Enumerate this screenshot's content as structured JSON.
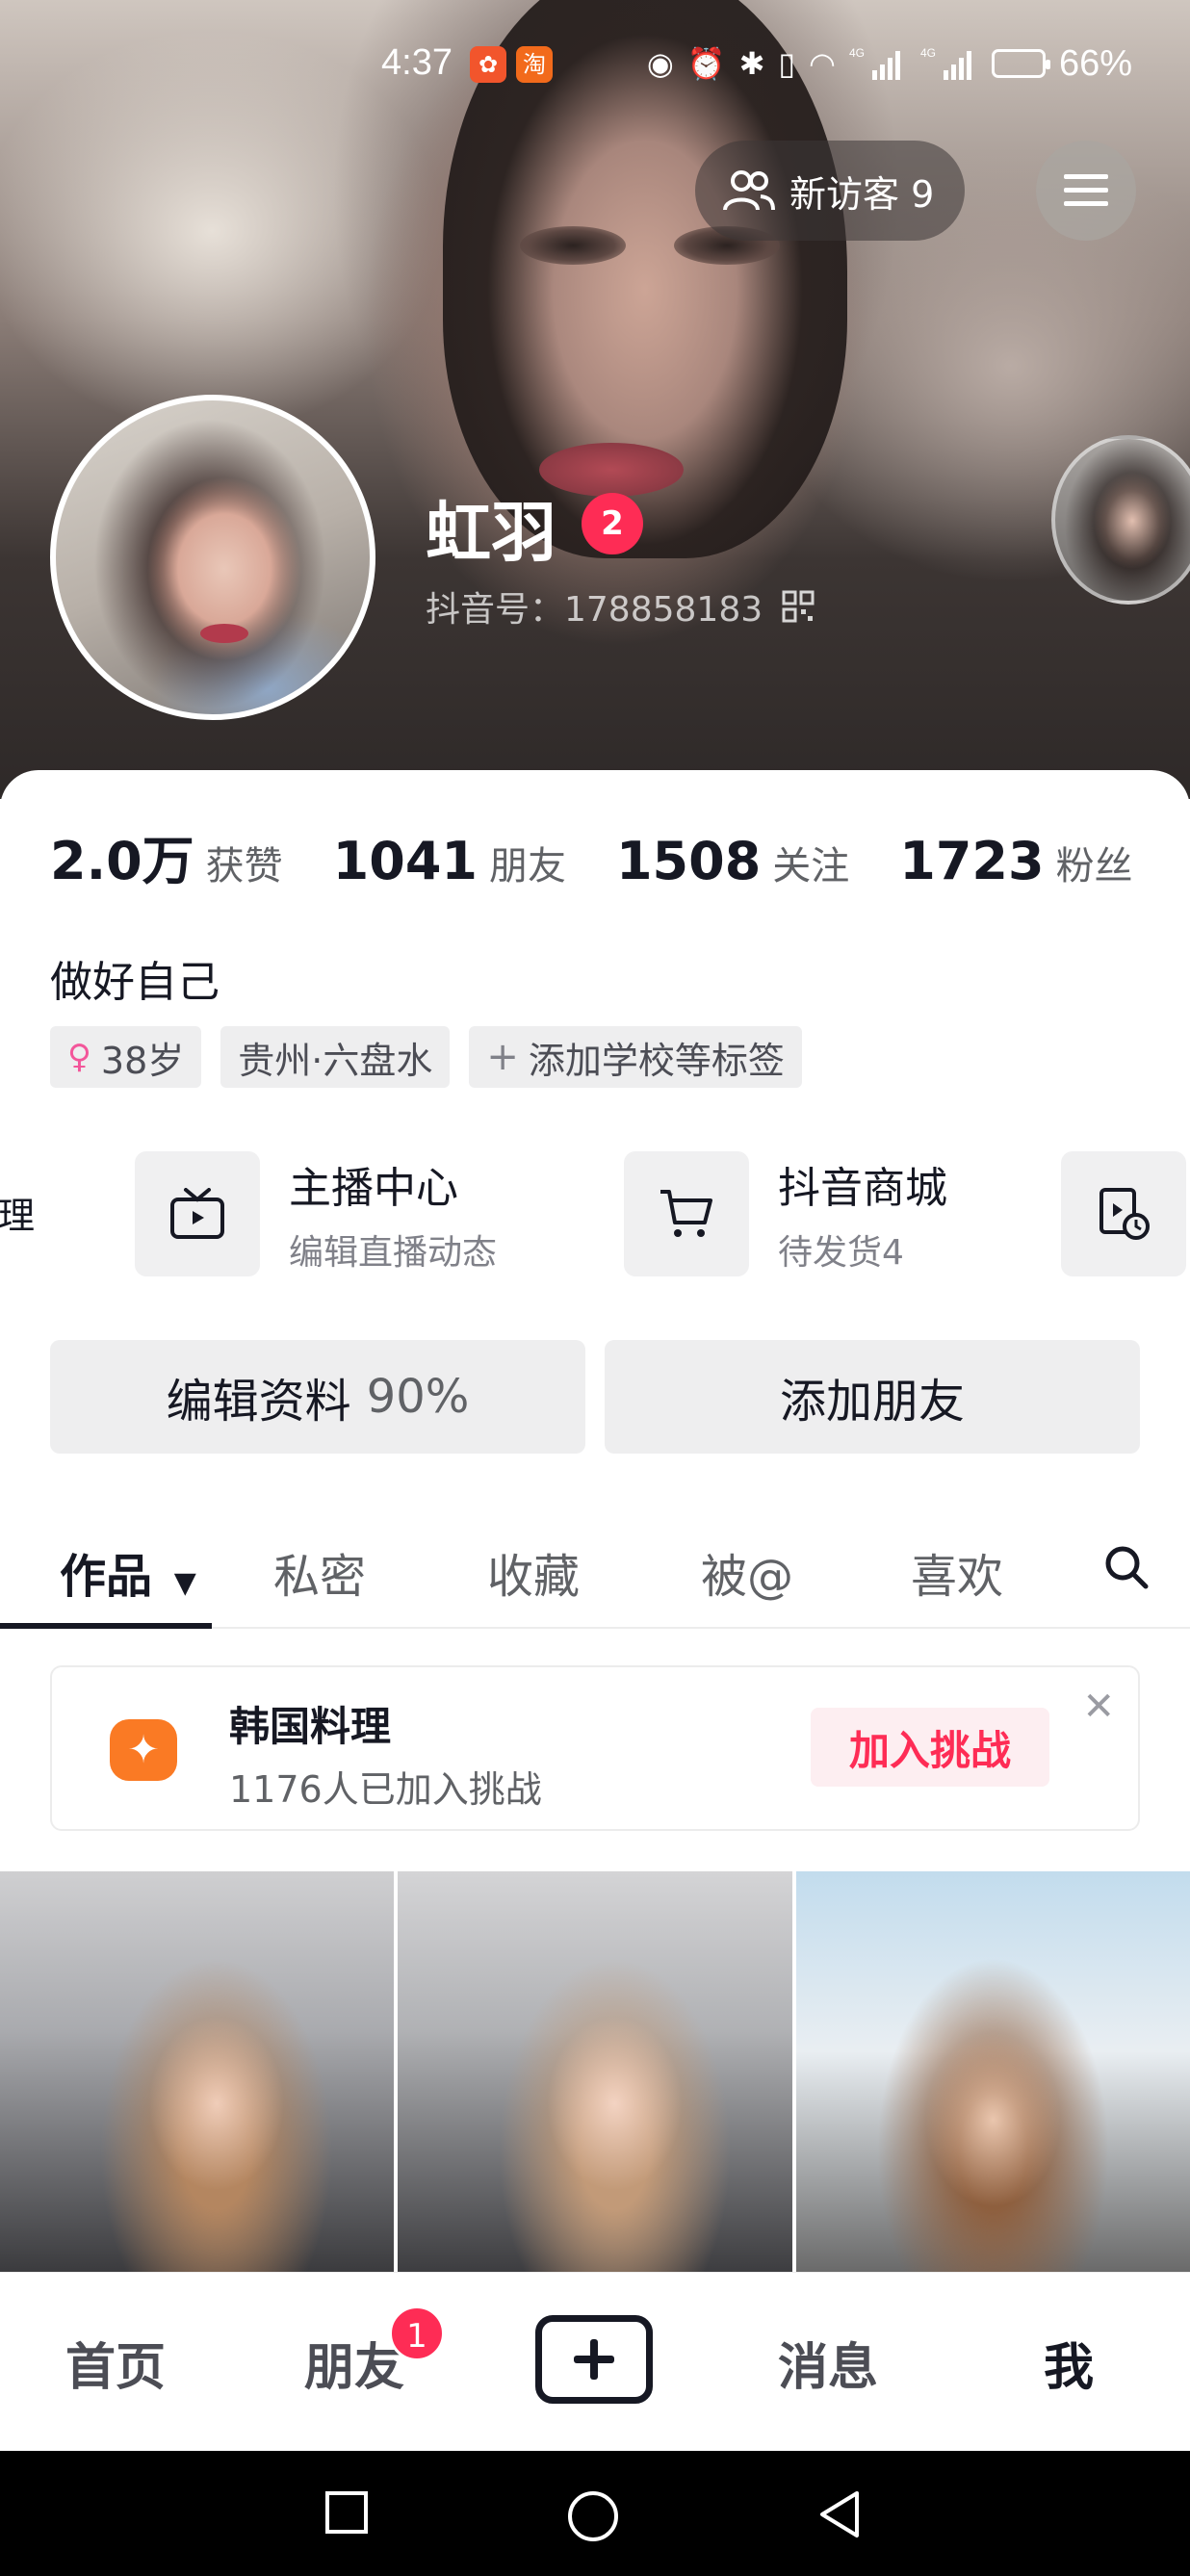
{
  "status_bar": {
    "time": "4:37",
    "battery_percent": "66%",
    "battery_level": 0.66,
    "app_icons": [
      "notification-app-icon",
      "taobao-icon"
    ],
    "network": "4G"
  },
  "header": {
    "visitors_label": "新访客 9",
    "menu_icon": "hamburger-menu-icon"
  },
  "profile": {
    "nickname": "虹羽",
    "level": "2",
    "douyin_id": "抖音号：178858183"
  },
  "stats": [
    {
      "num": "2.0万",
      "label": "获赞"
    },
    {
      "num": "1041",
      "label": "朋友"
    },
    {
      "num": "1508",
      "label": "关注"
    },
    {
      "num": "1723",
      "label": "粉丝"
    }
  ],
  "bio": "做好自己",
  "tags": [
    {
      "icon": "female-icon",
      "text": "38岁"
    },
    {
      "icon": "",
      "text": "贵州·六盘水"
    },
    {
      "icon": "plus-icon",
      "text": "添加学校等标签"
    }
  ],
  "shortcuts": {
    "edge_text": "理",
    "items": [
      {
        "title": "主播中心",
        "sub": "编辑直播动态",
        "icon": "tv-icon"
      },
      {
        "title": "抖音商城",
        "sub": "待发货4",
        "icon": "cart-icon"
      }
    ]
  },
  "actions": {
    "edit_label": "编辑资料",
    "edit_progress": "90%",
    "add_friend_label": "添加朋友"
  },
  "tabs": [
    "作品",
    "私密",
    "收藏",
    "被@",
    "喜欢"
  ],
  "challenge": {
    "title": "韩国料理",
    "sub": "1176人已加入挑战",
    "button": "加入挑战"
  },
  "bottom_nav": {
    "items": [
      "首页",
      "朋友",
      "消息",
      "我"
    ],
    "friends_badge": "1"
  },
  "colors": {
    "accent": "#fe2c55",
    "challenge_icon": "#fa7a24",
    "text_primary": "#161823",
    "text_secondary": "#606266"
  }
}
